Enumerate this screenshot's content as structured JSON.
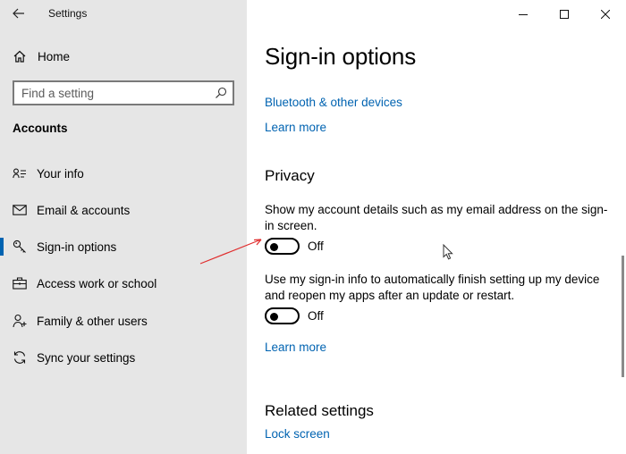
{
  "window": {
    "title": "Settings"
  },
  "sidebar": {
    "home_label": "Home",
    "search_placeholder": "Find a setting",
    "section_title": "Accounts",
    "items": [
      {
        "label": "Your info",
        "icon": "person-card-icon"
      },
      {
        "label": "Email & accounts",
        "icon": "mail-icon"
      },
      {
        "label": "Sign-in options",
        "icon": "key-icon",
        "selected": true
      },
      {
        "label": "Access work or school",
        "icon": "briefcase-icon"
      },
      {
        "label": "Family & other users",
        "icon": "person-add-icon"
      },
      {
        "label": "Sync your settings",
        "icon": "sync-icon"
      }
    ]
  },
  "main": {
    "title": "Sign-in options",
    "bluetooth_link": "Bluetooth & other devices",
    "learn_more_1": "Learn more",
    "privacy": {
      "heading": "Privacy",
      "setting1": {
        "description": "Show my account details such as my email address on the sign-in screen.",
        "state": "Off"
      },
      "setting2": {
        "description": "Use my sign-in info to automatically finish setting up my device and reopen my apps after an update or restart.",
        "state": "Off"
      },
      "learn_more": "Learn more"
    },
    "related": {
      "heading": "Related settings",
      "lock_screen": "Lock screen"
    }
  },
  "colors": {
    "accent": "#0063b1",
    "sidebar_bg": "#e6e6e6",
    "annotation_arrow": "#e02b2b"
  }
}
